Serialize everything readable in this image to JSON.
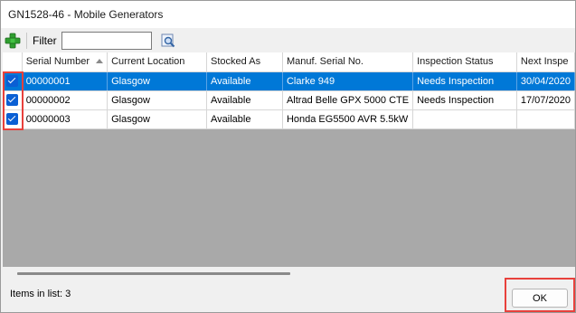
{
  "window": {
    "title": "GN1528-46 - Mobile Generators"
  },
  "toolbar": {
    "add_icon": "add-plus-icon",
    "filter_label": "Filter",
    "filter_value": "",
    "search_icon": "search-magnifier-icon"
  },
  "table": {
    "columns": [
      "Serial Number",
      "Current Location",
      "Stocked As",
      "Manuf. Serial No.",
      "Inspection Status",
      "Next Inspe"
    ],
    "sorted_column": "Serial Number",
    "rows": [
      {
        "checked": true,
        "selected": true,
        "cells": [
          "00000001",
          "Glasgow",
          "Available",
          "Clarke 949",
          "Needs Inspection",
          "30/04/2020"
        ]
      },
      {
        "checked": true,
        "selected": false,
        "cells": [
          "00000002",
          "Glasgow",
          "Available",
          "Altrad Belle GPX 5000 CTE",
          "Needs Inspection",
          "17/07/2020"
        ]
      },
      {
        "checked": true,
        "selected": false,
        "cells": [
          "00000003",
          "Glasgow",
          "Available",
          "Honda EG5500 AVR 5.5kW",
          "",
          ""
        ]
      }
    ]
  },
  "status": {
    "items_label": "Items in list: 3"
  },
  "footer": {
    "ok_label": "OK"
  },
  "colors": {
    "selection": "#0078d7",
    "highlight": "#e8413c",
    "grid_empty": "#a9a9a9"
  }
}
